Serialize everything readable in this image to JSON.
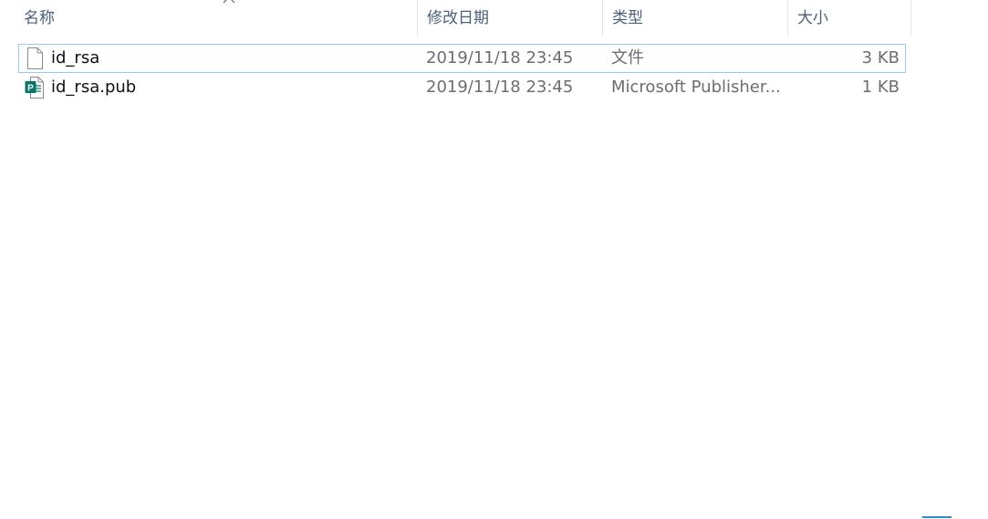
{
  "columns": {
    "name": "名称",
    "date": "修改日期",
    "type": "类型",
    "size": "大小"
  },
  "sort": {
    "column": "name",
    "direction": "ascending",
    "icon": "chevron-up-icon"
  },
  "files": [
    {
      "name": "id_rsa",
      "modified": "2019/11/18 23:45",
      "type": "文件",
      "size": "3 KB",
      "icon": "generic-file-icon",
      "focused": true
    },
    {
      "name": "id_rsa.pub",
      "modified": "2019/11/18 23:45",
      "type": "Microsoft Publisher...",
      "size": "1 KB",
      "icon": "publisher-file-icon",
      "focused": false
    }
  ],
  "colors": {
    "header_text": "#4c607a",
    "focus_border": "#99c9ef",
    "publisher_green": "#077568",
    "secondary_text": "#6d6d6d"
  }
}
